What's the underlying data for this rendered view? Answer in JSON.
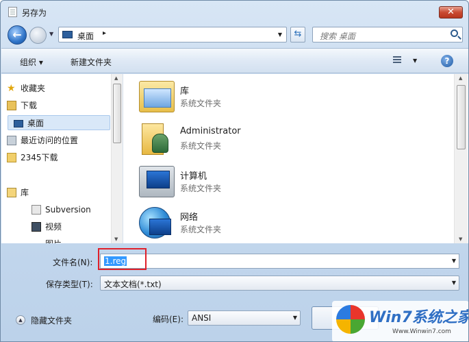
{
  "window": {
    "title": "另存为",
    "close_label": "✕"
  },
  "nav": {
    "back_glyph": "←",
    "history_glyph": "▼",
    "address": {
      "location": "桌面",
      "separator": "▸",
      "dropdown": "▼"
    },
    "refresh_glyph": "⇆",
    "search": {
      "placeholder": "搜索 桌面"
    }
  },
  "toolbar": {
    "organize_label": "组织 ▾",
    "new_folder_label": "新建文件夹",
    "view_dropdown": "▼",
    "help_glyph": "?"
  },
  "sidebar": {
    "items": [
      {
        "label": "收藏夹",
        "icon": "star-icon"
      },
      {
        "label": "下载",
        "icon": "download-folder-icon"
      },
      {
        "label": "桌面",
        "icon": "desktop-icon",
        "selected": true
      },
      {
        "label": "最近访问的位置",
        "icon": "recent-places-icon"
      },
      {
        "label": "2345下载",
        "icon": "folder-icon"
      },
      {
        "label": "库",
        "icon": "library-icon"
      },
      {
        "label": "Subversion",
        "icon": "subversion-icon"
      },
      {
        "label": "视频",
        "icon": "video-icon"
      },
      {
        "label": "图片",
        "icon": "pictures-icon"
      }
    ]
  },
  "files": [
    {
      "name": "库",
      "type": "系统文件夹",
      "icon": "library-icon"
    },
    {
      "name": "Administrator",
      "type": "系统文件夹",
      "icon": "user-folder-icon"
    },
    {
      "name": "计算机",
      "type": "系统文件夹",
      "icon": "computer-icon"
    },
    {
      "name": "网络",
      "type": "系统文件夹",
      "icon": "network-icon"
    }
  ],
  "form": {
    "filename_label": "文件名(N):",
    "filename_value": "1.reg",
    "type_label": "保存类型(T):",
    "type_value": "文本文档(*.txt)",
    "encoding_label": "编码(E):",
    "encoding_value": "ANSI",
    "hide_folders_label": "隐藏文件夹",
    "dropdown_glyph": "▼"
  },
  "watermark": {
    "title": "Win7系统之家",
    "url": "Www.Winwin7.com"
  },
  "colors": {
    "highlight": "#e0202a",
    "selection": "#3399ff",
    "close": "#c94a32"
  }
}
